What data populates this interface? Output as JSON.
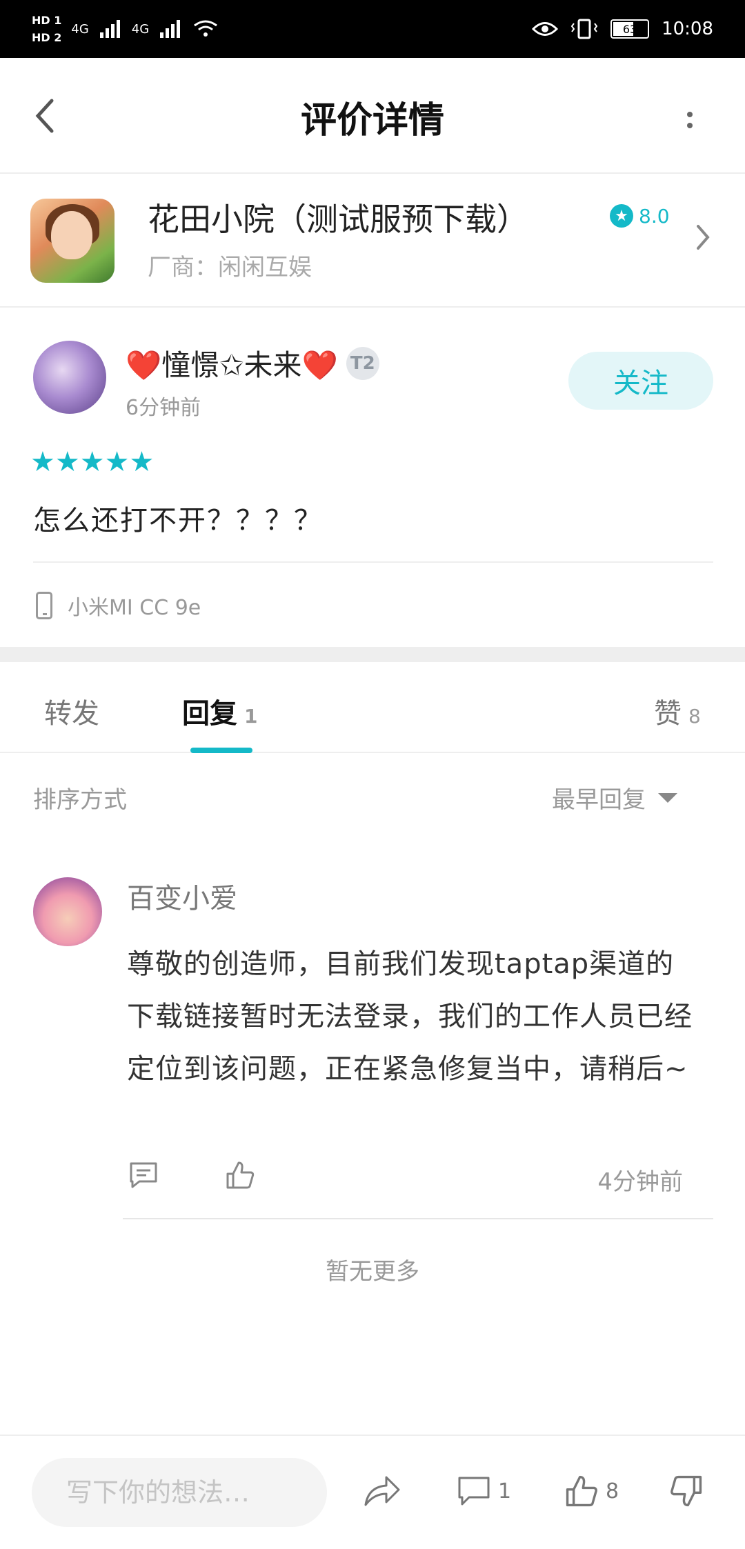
{
  "status_bar": {
    "hd1": "HD 1",
    "hd2": "HD 2",
    "signal1": "4G",
    "signal2": "4G",
    "battery": "63",
    "battery_level_percent": 63,
    "time": "10:08"
  },
  "header": {
    "title": "评价详情"
  },
  "app": {
    "name": "花田小院（测试服预下载）",
    "rating": "8.0",
    "vendor": "厂商：闲闲互娱"
  },
  "review": {
    "username": "❤️憧憬✩未来❤️",
    "badge": "T2",
    "time": "6分钟前",
    "follow_label": "关注",
    "stars": 5,
    "stars_text": "★★★★★",
    "text": "怎么还打不开？？？？",
    "device": "小米MI CC 9e"
  },
  "tabs": {
    "forward": "转发",
    "reply": "回复",
    "reply_count": "1",
    "like": "赞",
    "like_count": "8"
  },
  "sort": {
    "label": "排序方式",
    "value": "最早回复"
  },
  "reply": {
    "username": "百变小爱",
    "text": "尊敬的创造师，目前我们发现taptap渠道的下载链接暂时无法登录，我们的工作人员已经定位到该问题，正在紧急修复当中，请稍后~",
    "time": "4分钟前"
  },
  "no_more": "暂无更多",
  "bottom_bar": {
    "placeholder": "写下你的想法…",
    "comment_count": "1",
    "like_count": "8"
  },
  "colors": {
    "accent": "#14b9c8",
    "follow_bg": "#e3f6f8"
  }
}
